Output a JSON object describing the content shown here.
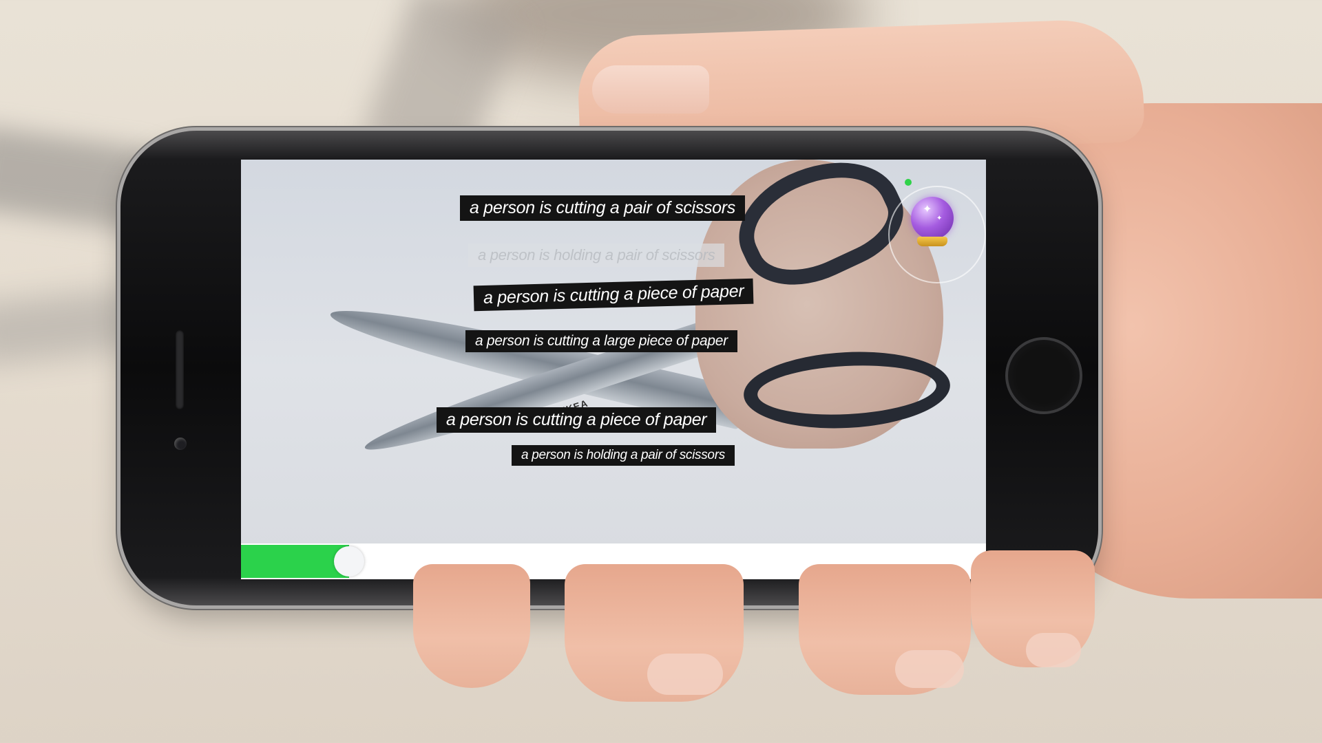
{
  "captions": [
    {
      "text": "a person is cutting a pair of scissors",
      "faded": false
    },
    {
      "text": "a person is holding a pair of scissors",
      "faded": true
    },
    {
      "text": "a person is cutting a piece of paper",
      "faded": false
    },
    {
      "text": "a person is cutting a large piece of paper",
      "faded": false
    },
    {
      "text": "a person is cutting a piece of paper",
      "faded": false
    },
    {
      "text": "a person is holding a pair of scissors",
      "faded": false
    }
  ],
  "scene": {
    "brand_mark": "IKEA"
  },
  "progress": {
    "fraction": 0.145
  },
  "icons": {
    "crystal_ball": "crystal-ball-icon",
    "home_button": "home-button"
  },
  "colors": {
    "progress": "#2bd24b",
    "caption_bg": "#141414",
    "caption_text": "#ffffff",
    "crystal_ball": "#a55ce0"
  }
}
